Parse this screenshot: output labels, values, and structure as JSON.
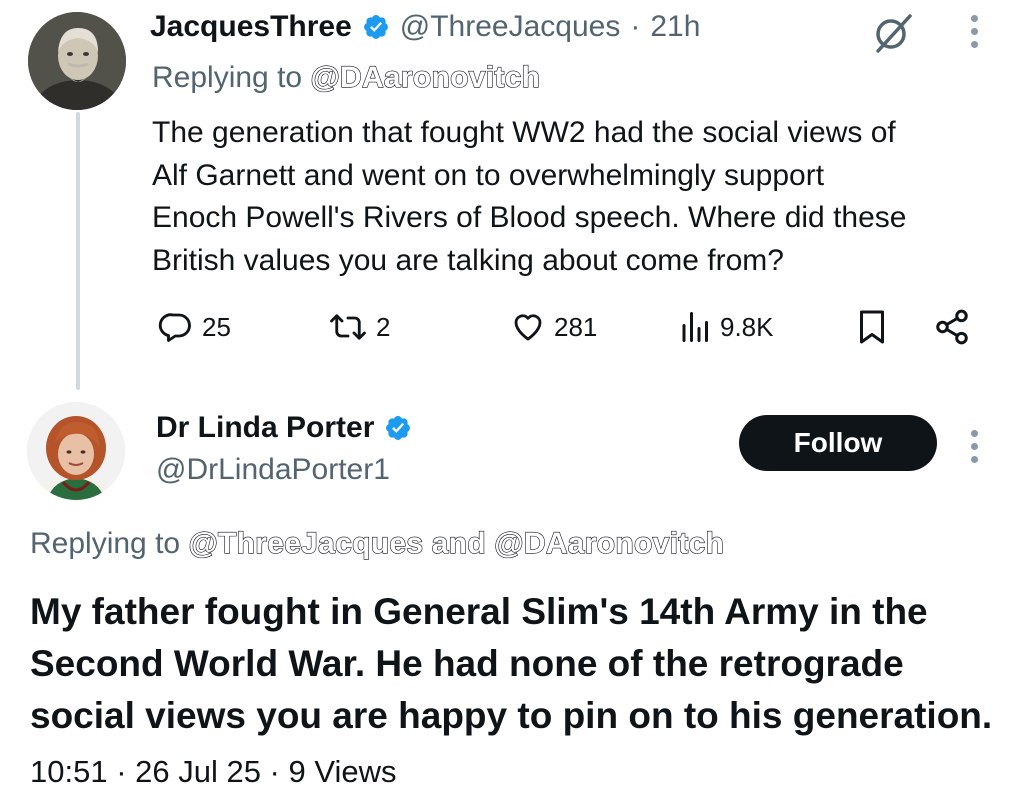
{
  "tweet1": {
    "display_name": "JacquesThree",
    "handle": "@ThreeJacques",
    "separator": "·",
    "time": "21h",
    "replying_prefix": "Replying to",
    "replying_to": "@DAaronovitch",
    "text_lines": [
      "The generation that fought WW2 had the social views of",
      "Alf Garnett and went on to overwhelmingly support",
      "Enoch Powell's Rivers of Blood speech. Where did these",
      "British values you are talking about come from?"
    ],
    "stats": {
      "replies": "25",
      "reposts": "2",
      "likes": "281",
      "views": "9.8K"
    }
  },
  "tweet2": {
    "display_name": "Dr Linda Porter",
    "handle": "@DrLindaPorter1",
    "follow_label": "Follow",
    "replying_prefix": "Replying to",
    "replying_to_1": "@ThreeJacques",
    "replying_and": "and",
    "replying_to_2": "@DAaronovitch",
    "text_lines": [
      "My father fought in General Slim's 14th Army in the",
      "Second World War. He had none of the retrograde",
      "social views you are happy to pin on to his generation."
    ],
    "meta": "10:51 · 26 Jul 25 · 9 Views"
  },
  "colors": {
    "verified": "#1d9bf0",
    "muted": "#536471",
    "text": "#0f1419",
    "thread_line": "#cfd9de"
  },
  "icons": [
    "verified-badge-icon",
    "grok-icon",
    "more-icon",
    "reply-icon",
    "repost-icon",
    "like-icon",
    "views-icon",
    "bookmark-icon",
    "share-icon"
  ]
}
